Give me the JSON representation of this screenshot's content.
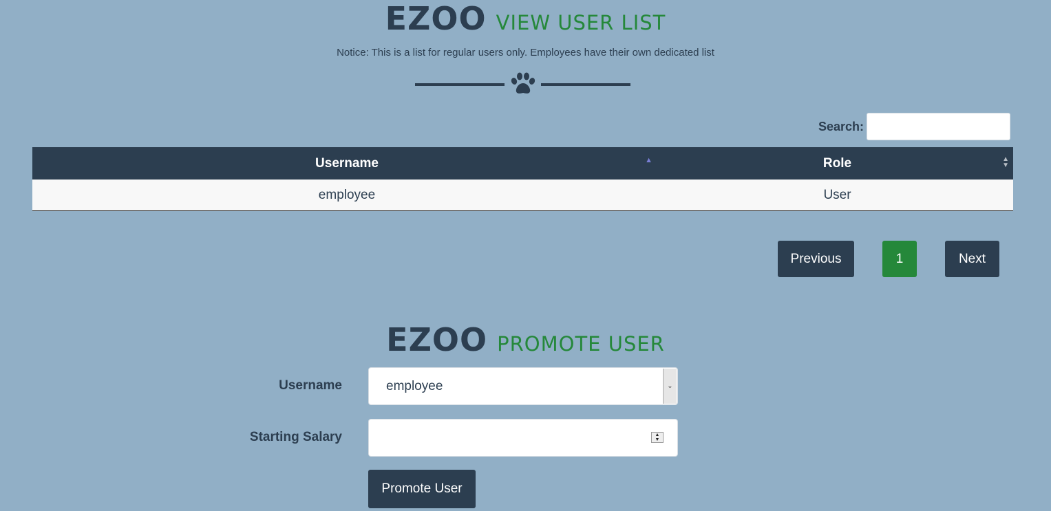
{
  "list_section": {
    "brand": "EZOO",
    "subtitle": "VIEW USER LIST",
    "notice": "Notice: This is a list for regular users only. Employees have their own dedicated list",
    "divider_icon": "paw-icon"
  },
  "search": {
    "label": "Search:",
    "value": ""
  },
  "table": {
    "columns": [
      "Username",
      "Role"
    ],
    "sort": {
      "column": "Username",
      "direction": "ascending"
    },
    "rows": [
      [
        "employee",
        "User"
      ]
    ]
  },
  "pagination": {
    "previous": "Previous",
    "current_page": "1",
    "next": "Next"
  },
  "promote_section": {
    "brand": "EZOO",
    "subtitle": "PROMOTE USER",
    "username_label": "Username",
    "username_value": "employee",
    "salary_label": "Starting Salary",
    "salary_value": "",
    "submit": "Promote User"
  },
  "colors": {
    "background": "#91afc6",
    "navy": "#2c3e50",
    "green": "#25883a"
  }
}
